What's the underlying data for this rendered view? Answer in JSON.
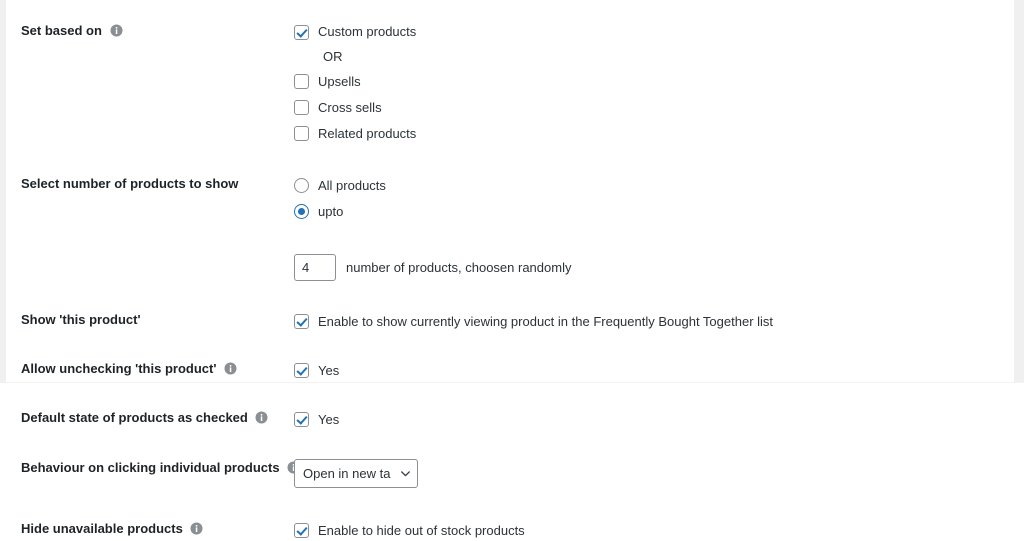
{
  "theme": {
    "accent": "#2271b1",
    "label_color": "#1d2327",
    "text_color": "#2c3338",
    "control_border": "#8c8f94",
    "gutter": "#f0f0f1"
  },
  "settings": {
    "rows": [
      {
        "label": "Set based on",
        "has_info": true,
        "type": "checkbox-group",
        "or_text": "OR",
        "options": [
          {
            "label": "Custom products",
            "checked": true
          },
          {
            "label": "Upsells",
            "checked": false
          },
          {
            "label": "Cross sells",
            "checked": false
          },
          {
            "label": "Related products",
            "checked": false
          }
        ]
      },
      {
        "label": "Select number of products to show",
        "has_info": false,
        "type": "radio-group",
        "options": [
          {
            "label": "All products",
            "checked": false
          },
          {
            "label": "upto",
            "checked": true
          }
        ],
        "number_value": "4",
        "number_placeholder": "",
        "number_caption": "number of products, choosen randomly"
      },
      {
        "label": "Show 'this product'",
        "has_info": false,
        "type": "checkbox",
        "options": [
          {
            "label": "Enable to show currently viewing product in the Frequently Bought Together list",
            "checked": true
          }
        ]
      },
      {
        "label": "Allow unchecking 'this product'",
        "has_info": true,
        "type": "checkbox",
        "options": [
          {
            "label": "Yes",
            "checked": true
          }
        ]
      },
      {
        "label": "Default state of products as checked",
        "has_info": true,
        "type": "checkbox",
        "options": [
          {
            "label": "Yes",
            "checked": true
          }
        ]
      },
      {
        "label": "Behaviour on clicking individual products",
        "has_info": true,
        "type": "select",
        "select_value": "Open in new tab",
        "select_options": [
          "Open in new tab"
        ]
      },
      {
        "label": "Hide unavailable products",
        "has_info": true,
        "type": "checkbox",
        "options": [
          {
            "label": "Enable to hide out of stock products",
            "checked": true
          }
        ]
      }
    ]
  }
}
